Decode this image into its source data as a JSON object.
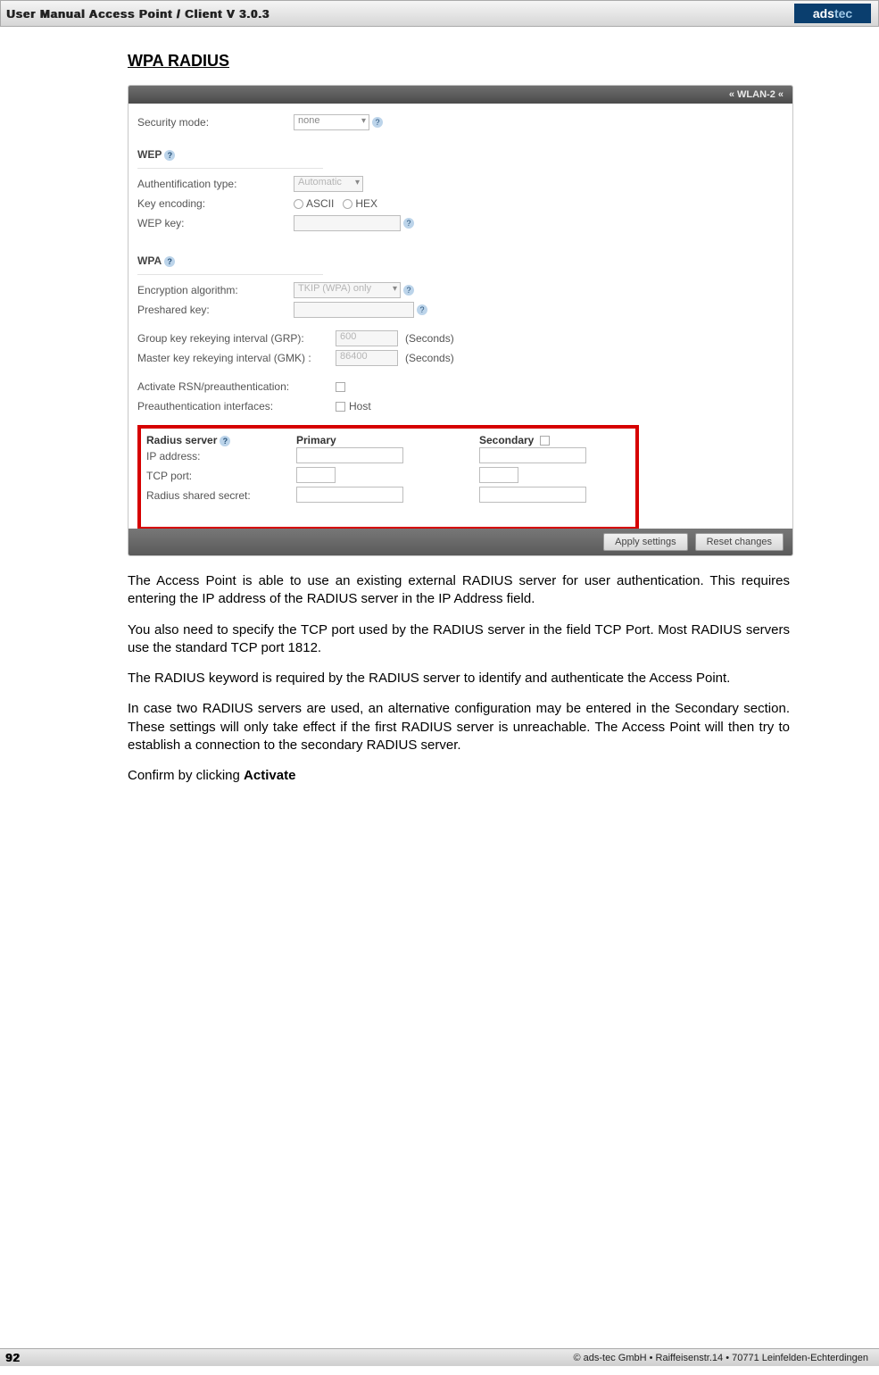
{
  "header": {
    "title": "User Manual Access Point / Client V 3.0.3",
    "logo_a": "ads",
    "logo_b": "tec"
  },
  "section_title": "WPA RADIUS",
  "shot": {
    "breadcrumb": "« WLAN-2 «",
    "security_mode_label": "Security mode:",
    "security_mode_value": "none",
    "wep_head": "WEP",
    "auth_type_label": "Authentification type:",
    "auth_type_value": "Automatic",
    "key_encoding_label": "Key encoding:",
    "key_encoding_ascii": "ASCII",
    "key_encoding_hex": "HEX",
    "wep_key_label": "WEP key:",
    "wpa_head": "WPA",
    "enc_alg_label": "Encryption algorithm:",
    "enc_alg_value": "TKIP (WPA) only",
    "psk_label": "Preshared key:",
    "grp_label": "Group key rekeying interval (GRP):",
    "grp_value": "600",
    "gmk_label": "Master key rekeying interval (GMK) :",
    "gmk_value": "86400",
    "seconds": "(Seconds)",
    "rsn_label": "Activate RSN/preauthentication:",
    "preauth_if_label": "Preauthentication interfaces:",
    "preauth_if_value": "Host",
    "radius_head": "Radius server",
    "primary": "Primary",
    "secondary": "Secondary",
    "ip_label": "IP address:",
    "tcp_label": "TCP port:",
    "secret_label": "Radius shared secret:",
    "apply_btn": "Apply settings",
    "reset_btn": "Reset changes"
  },
  "paras": {
    "p1": "The Access Point is able to use an existing external RADIUS server for user authentication. This requires entering the IP address of the RADIUS server in the IP Address field.",
    "p2": "You also need to specify the TCP port used by the RADIUS server in the field TCP Port. Most RADIUS servers use the standard TCP port 1812.",
    "p3": "The RADIUS keyword is required by the RADIUS server to identify and authenticate the Access Point.",
    "p4": "In case two RADIUS servers are used, an alternative configuration may be entered in the Secondary section. These settings will only take effect if the first RADIUS server is unreachable. The Access Point will then try to establish a connection to the secondary RADIUS server.",
    "p5a": "Confirm by clicking ",
    "p5b": "Activate"
  },
  "footer": {
    "page": "92",
    "copy": "© ads-tec GmbH • Raiffeisenstr.14 • 70771 Leinfelden-Echterdingen"
  }
}
